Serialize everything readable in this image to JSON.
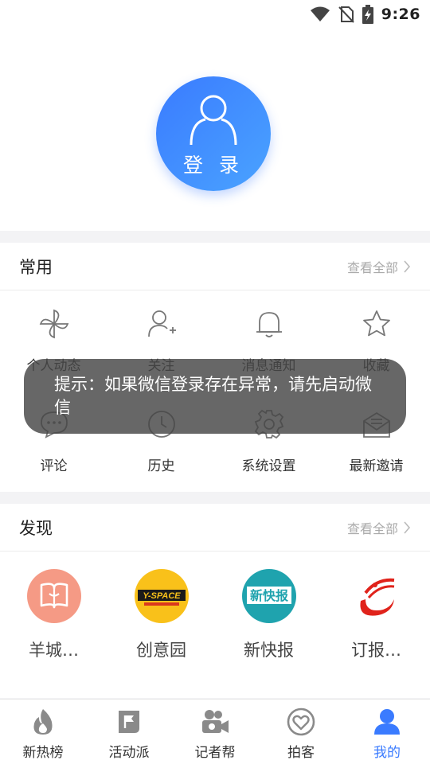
{
  "status_bar": {
    "time": "9:26",
    "icons": [
      "wifi-icon",
      "no-sim-icon",
      "battery-charging-icon"
    ]
  },
  "login": {
    "label": "登 录",
    "icon": "user-icon"
  },
  "common": {
    "title": "常用",
    "see_all": "查看全部",
    "items": [
      {
        "label": "个人动态",
        "icon": "pinwheel-icon"
      },
      {
        "label": "关注",
        "icon": "add-user-icon"
      },
      {
        "label": "消息通知",
        "icon": "bell-icon"
      },
      {
        "label": "收藏",
        "icon": "star-icon"
      },
      {
        "label": "评论",
        "icon": "comment-icon"
      },
      {
        "label": "历史",
        "icon": "clock-icon"
      },
      {
        "label": "系统设置",
        "icon": "gear-icon"
      },
      {
        "label": "最新邀请",
        "icon": "mail-icon"
      }
    ]
  },
  "discover": {
    "title": "发现",
    "see_all": "查看全部",
    "items": [
      {
        "label": "羊城…",
        "logo": "book-logo",
        "logo_text": ""
      },
      {
        "label": "创意园",
        "logo": "y-space-logo",
        "logo_text": "Y-SPACE"
      },
      {
        "label": "新快报",
        "logo": "xinkuaibao-logo",
        "logo_text": "新快报"
      },
      {
        "label": "订报…",
        "logo": "subscription-logo",
        "logo_text": ""
      }
    ]
  },
  "tabbar": {
    "items": [
      {
        "label": "新热榜",
        "icon": "flame-icon",
        "active": false
      },
      {
        "label": "活动派",
        "icon": "flag-icon",
        "active": false
      },
      {
        "label": "记者帮",
        "icon": "camera-icon",
        "active": false
      },
      {
        "label": "拍客",
        "icon": "heart-icon",
        "active": false
      },
      {
        "label": "我的",
        "icon": "user-icon",
        "active": true
      }
    ]
  },
  "toast": {
    "text": "提示：如果微信登录存在异常，请先启动微信"
  },
  "colors": {
    "accent": "#3a7bff",
    "icon_gray": "#888888",
    "background": "#f3f3f5"
  }
}
